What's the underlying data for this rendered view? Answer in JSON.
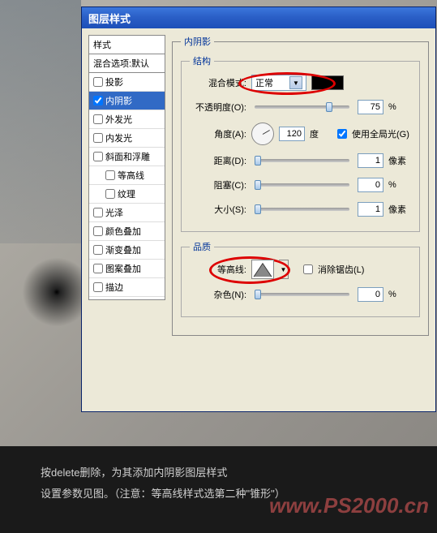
{
  "window": {
    "title": "图层样式"
  },
  "sidebar": {
    "header": "样式",
    "sub": "混合选项:默认",
    "items": [
      {
        "label": "投影",
        "checked": false,
        "selected": false,
        "indent": false
      },
      {
        "label": "内阴影",
        "checked": true,
        "selected": true,
        "indent": false
      },
      {
        "label": "外发光",
        "checked": false,
        "selected": false,
        "indent": false
      },
      {
        "label": "内发光",
        "checked": false,
        "selected": false,
        "indent": false
      },
      {
        "label": "斜面和浮雕",
        "checked": false,
        "selected": false,
        "indent": false
      },
      {
        "label": "等高线",
        "checked": false,
        "selected": false,
        "indent": true
      },
      {
        "label": "纹理",
        "checked": false,
        "selected": false,
        "indent": true
      },
      {
        "label": "光泽",
        "checked": false,
        "selected": false,
        "indent": false
      },
      {
        "label": "颜色叠加",
        "checked": false,
        "selected": false,
        "indent": false
      },
      {
        "label": "渐变叠加",
        "checked": false,
        "selected": false,
        "indent": false
      },
      {
        "label": "图案叠加",
        "checked": false,
        "selected": false,
        "indent": false
      },
      {
        "label": "描边",
        "checked": false,
        "selected": false,
        "indent": false
      }
    ]
  },
  "panel": {
    "title": "内阴影",
    "structure": {
      "legend": "结构",
      "blend_mode_label": "混合模式:",
      "blend_mode_value": "正常",
      "opacity_label": "不透明度(O):",
      "opacity_value": "75",
      "opacity_unit": "%",
      "angle_label": "角度(A):",
      "angle_value": "120",
      "angle_unit": "度",
      "global_light_label": "使用全局光(G)",
      "global_light_checked": true,
      "distance_label": "距离(D):",
      "distance_value": "1",
      "distance_unit": "像素",
      "choke_label": "阻塞(C):",
      "choke_value": "0",
      "choke_unit": "%",
      "size_label": "大小(S):",
      "size_value": "1",
      "size_unit": "像素"
    },
    "quality": {
      "legend": "品质",
      "contour_label": "等高线:",
      "antialias_label": "消除锯齿(L)",
      "antialias_checked": false,
      "noise_label": "杂色(N):",
      "noise_value": "0",
      "noise_unit": "%"
    }
  },
  "caption": {
    "line1": "按delete删除，为其添加内阴影图层样式",
    "line2": "设置参数见图。（注意：等高线样式选第二种\"锥形\"）"
  },
  "watermark": "www.PS2000.cn"
}
